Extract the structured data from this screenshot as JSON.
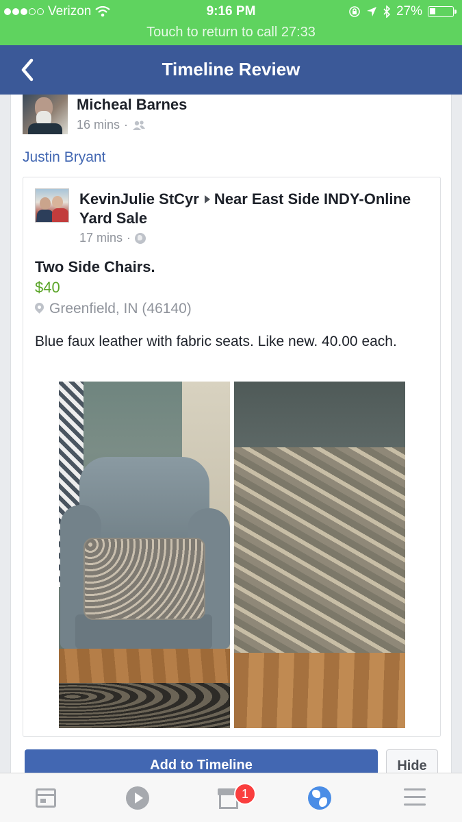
{
  "status_bar": {
    "carrier": "Verizon",
    "time": "9:16 PM",
    "battery": "27%",
    "battery_level": 0.27,
    "call_banner": "Touch to return to call 27:33",
    "icons": [
      "signal-dots-icon",
      "wifi-icon",
      "orientation-lock-icon",
      "location-arrow-icon",
      "bluetooth-icon",
      "battery-icon"
    ]
  },
  "nav": {
    "back_icon": "chevron-left-icon",
    "title": "Timeline Review"
  },
  "post": {
    "author": "Micheal Barnes",
    "time": "16 mins",
    "separator": "·",
    "privacy_icon": "friends-icon",
    "tagged": "Justin Bryant"
  },
  "shared": {
    "author": "KevinJulie StCyr",
    "group": "Near East Side INDY-Online Yard Sale",
    "time": "17 mins",
    "separator": "·",
    "privacy_icon": "globe-icon",
    "title": "Two Side Chairs.",
    "price": "$40",
    "location": "Greenfield, IN (46140)",
    "description": "Blue faux leather with fabric seats. Like new. 40.00 each.",
    "photos": [
      "chair-photo",
      "seat-fabric-photo"
    ]
  },
  "actions": {
    "add": "Add to Timeline",
    "hide": "Hide"
  },
  "tabbar": {
    "tabs": [
      {
        "icon": "news-feed-icon"
      },
      {
        "icon": "video-icon"
      },
      {
        "icon": "marketplace-icon",
        "badge": "1"
      },
      {
        "icon": "globe-icon",
        "active": true
      },
      {
        "icon": "menu-icon"
      }
    ]
  },
  "colors": {
    "status_bar": "#5fd35f",
    "nav_bar": "#3b5998",
    "link": "#4267b2",
    "price": "#5ba529",
    "badge": "#fa3e3e"
  }
}
